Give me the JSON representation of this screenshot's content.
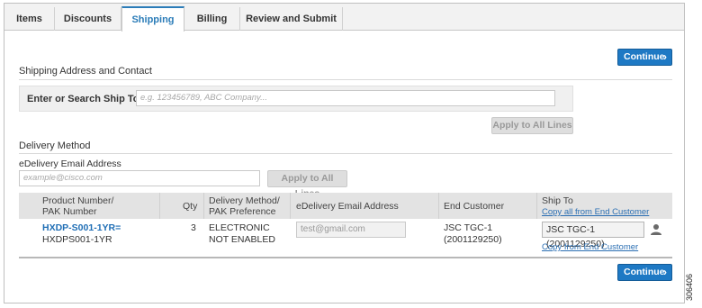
{
  "tabs": [
    {
      "label": "Items",
      "active": false
    },
    {
      "label": "Discounts",
      "active": false
    },
    {
      "label": "Shipping",
      "active": true
    },
    {
      "label": "Billing",
      "active": false
    },
    {
      "label": "Review and Submit",
      "active": false
    }
  ],
  "continue_label": "Continue",
  "shipping": {
    "section_title": "Shipping Address and Contact",
    "search_label": "Enter or Search Ship To",
    "search_placeholder": "e.g. 123456789, ABC Company...",
    "apply_all_label": "Apply to All Lines"
  },
  "delivery": {
    "section_title": "Delivery Method",
    "email_label": "eDelivery Email Address",
    "email_placeholder": "example@cisco.com",
    "apply_all_label": "Apply to All Lines"
  },
  "table": {
    "headers": {
      "product_line1": "Product Number/",
      "product_line2": "PAK Number",
      "qty": "Qty",
      "delivery_line1": "Delivery Method/",
      "delivery_line2": "PAK Preference",
      "email": "eDelivery Email Address",
      "end_customer": "End Customer",
      "ship_to": "Ship To",
      "copy_all_link": "Copy all from End Customer"
    },
    "rows": [
      {
        "product_number": "HXDP-S001-1YR=",
        "pak_number": "HXDPS001-1YR",
        "qty": "3",
        "delivery_line1": "ELECTRONIC",
        "delivery_line2": "NOT ENABLED",
        "email": "test@gmail.com",
        "end_customer_line1": "JSC TGC-1",
        "end_customer_line2": "(2001129250)",
        "ship_to": "JSC TGC-1 (2001129250)",
        "copy_link": "Copy from End Customer",
        "icon": "person-icon"
      }
    ]
  },
  "figure_id": "306406",
  "colors": {
    "accent": "#1e79c4",
    "link": "#2b6fb3"
  }
}
